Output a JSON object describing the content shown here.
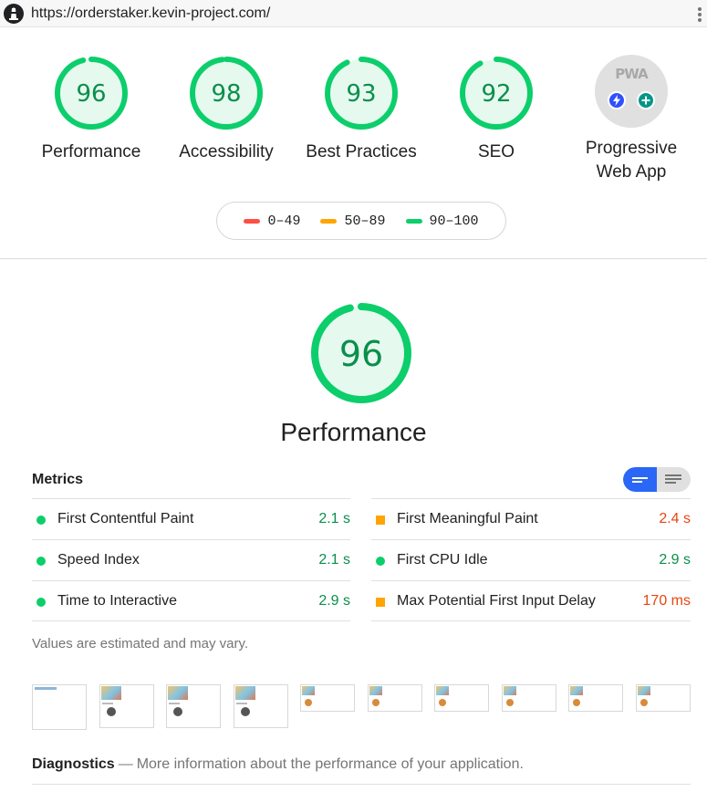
{
  "url_bar": {
    "url": "https://orderstaker.kevin-project.com/",
    "logo_icon": "lighthouse-icon",
    "menu_icon": "kebab-menu-icon"
  },
  "categories": [
    {
      "label": "Performance",
      "score": 96
    },
    {
      "label": "Accessibility",
      "score": 98
    },
    {
      "label": "Best Practices",
      "score": 93
    },
    {
      "label": "SEO",
      "score": 92
    }
  ],
  "pwa": {
    "badge_text": "PWA",
    "label_line1": "Progressive",
    "label_line2": "Web App",
    "icons": [
      "fast-reliable-icon",
      "installable-icon"
    ]
  },
  "legend": [
    {
      "range": "0–49",
      "color": "#ff4e42"
    },
    {
      "range": "50–89",
      "color": "#ffa400"
    },
    {
      "range": "90–100",
      "color": "#0cce6b"
    }
  ],
  "performance": {
    "score": 96,
    "title": "Performance"
  },
  "metrics": {
    "title": "Metrics",
    "left": [
      {
        "name": "First Contentful Paint",
        "value": "2.1 s",
        "rating": "pass"
      },
      {
        "name": "Speed Index",
        "value": "2.1 s",
        "rating": "pass"
      },
      {
        "name": "Time to Interactive",
        "value": "2.9 s",
        "rating": "pass"
      }
    ],
    "right": [
      {
        "name": "First Meaningful Paint",
        "value": "2.4 s",
        "rating": "average"
      },
      {
        "name": "First CPU Idle",
        "value": "2.9 s",
        "rating": "pass"
      },
      {
        "name": "Max Potential First Input Delay",
        "value": "170 ms",
        "rating": "average"
      }
    ],
    "disclaimer": "Values are estimated and may vary."
  },
  "colors": {
    "pass": "#0cce6b",
    "pass_text": "#0a8f4b",
    "average": "#ffa400",
    "average_text": "#e6470e",
    "fail": "#ff4e42",
    "toggle_active": "#2a67f6"
  },
  "diagnostics": {
    "title": "Diagnostics",
    "separator": "—",
    "description": "More information about the performance of your application."
  }
}
